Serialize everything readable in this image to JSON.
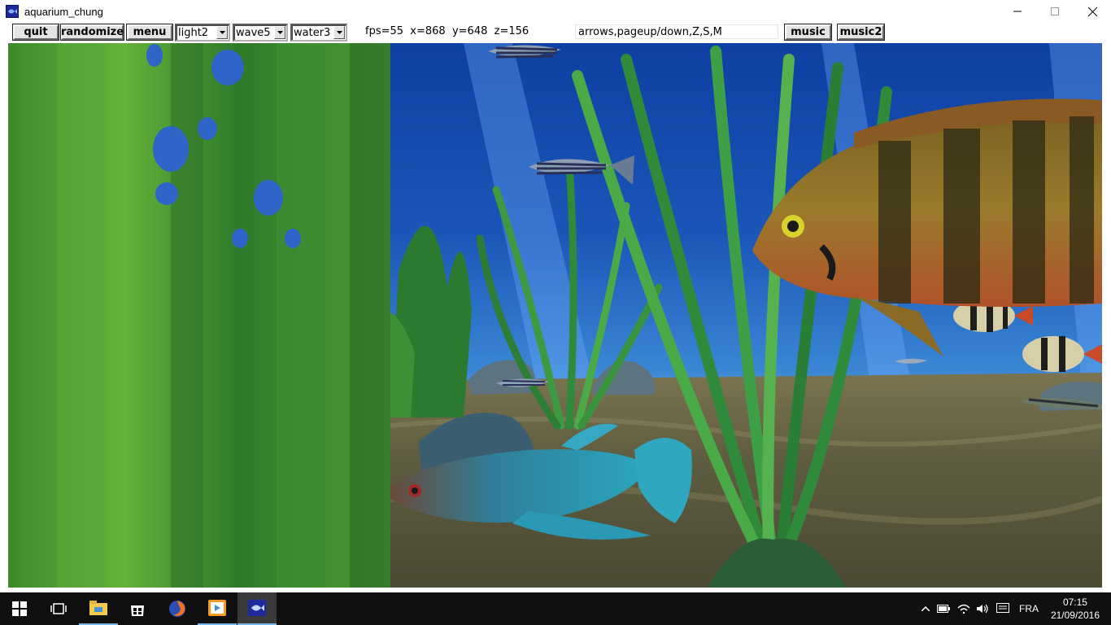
{
  "window": {
    "title": "aquarium_chung",
    "icons": {
      "app": "fish-icon",
      "minimize": "minimize-icon",
      "maximize": "maximize-icon",
      "close": "close-icon"
    }
  },
  "toolbar": {
    "quit_label": "quit",
    "randomize_label": "randomize",
    "menu_label": "menu",
    "light_value": "light2",
    "wave_value": "wave5",
    "water_value": "water3",
    "status": "fps=55  x=868  y=648  z=156",
    "keys_hint": "arrows,pageup/down,Z,S,M",
    "music_label": "music",
    "music2_label": "music2"
  },
  "taskbar": {
    "items": [
      "start-icon",
      "task-view-icon",
      "file-explorer-icon",
      "store-icon",
      "firefox-icon",
      "media-player-icon",
      "aquarium-app-icon"
    ],
    "tray_icons": [
      "chevron-up-icon",
      "battery-icon",
      "wifi-icon",
      "volume-icon",
      "notification-icon"
    ],
    "language": "FRA",
    "time": "07:15",
    "date": "21/09/2016"
  },
  "colors": {
    "water_top": "#0f3fa3",
    "water_bottom": "#5aa6d8",
    "sand": "#6b6a4a",
    "plant_green": "#2f8a3a",
    "taskbar": "#101010",
    "accent": "#76b9ed"
  }
}
